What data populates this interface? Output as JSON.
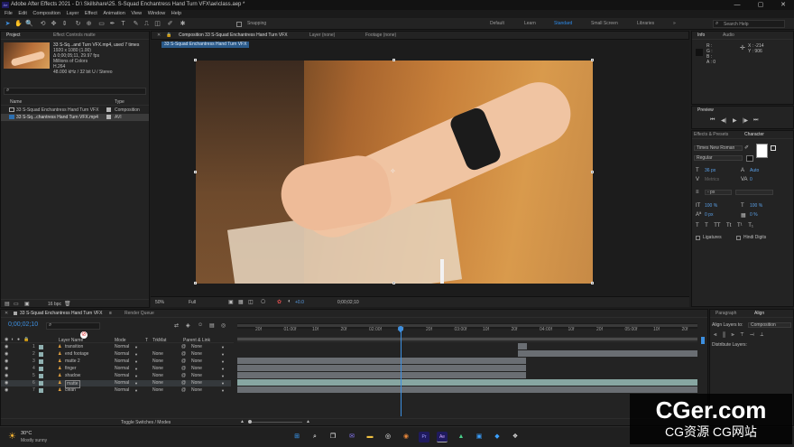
{
  "window": {
    "title": "Adobe After Effects 2021 - D:\\ Skillshare\\25. S-Squad Enchantress Hand Turn VFX\\ae\\class.aep *",
    "app_icon": "Ae"
  },
  "menu": [
    "File",
    "Edit",
    "Composition",
    "Layer",
    "Effect",
    "Animation",
    "View",
    "Window",
    "Help"
  ],
  "toolbar": {
    "snapping": "Snapping",
    "workspaces": [
      "Default",
      "Learn",
      "Standard",
      "Small Screen",
      "Libraries"
    ],
    "active_workspace": "Standard",
    "more": "»",
    "search_placeholder": "Search Help"
  },
  "project_panel": {
    "tabs": [
      "Project",
      "Effect Controls matte"
    ],
    "item_name": "33 S-Sq...and Turn VFX.mp4",
    "item_used": ", used 7 times",
    "info": [
      "1920 x 1080 (1.00)",
      "Δ 0;00;05;11, 29.97 fps",
      "Millions of Colors",
      "H.264",
      "48.000 kHz / 32 bit U / Stereo"
    ],
    "columns": {
      "name": "Name",
      "type": "Type"
    },
    "rows": [
      {
        "name": "33 S-Squad Enchantress Hand Turn VFX",
        "type": "Composition",
        "color": "#b5b5b5"
      },
      {
        "name": "33 S-Sq...chantress Hand Turn VFX.mp4",
        "type": "AVI",
        "color": "#b5b5b5"
      }
    ],
    "bpc": "16 bpc"
  },
  "viewer": {
    "tab_composition": "Composition 33 S-Squad Enchantress Hand Turn VFX",
    "tab_layer": "Layer (none)",
    "tab_footage": "Footage (none)",
    "comp_chip": "33 S-Squad Enchantress Hand Turn VFX",
    "zoom": "50%",
    "resolution": "Full",
    "exposure": "+0.0",
    "timecode": "0;00;02;10"
  },
  "info_panel": {
    "tabs": [
      "Info",
      "Audio"
    ],
    "x": "X : -214",
    "y": "Y : 906",
    "r": "R :",
    "g": "G :",
    "b": "B :",
    "a": "A : 0"
  },
  "preview": {
    "title": "Preview"
  },
  "effects": {
    "title": "Effects & Presets",
    "character_tab": "Character"
  },
  "character": {
    "font": "Times New Roman",
    "style": "Regular",
    "size": "36 px",
    "leading": "Auto",
    "kerning": "Metrics",
    "tracking": "0",
    "stroke": "- px",
    "vscale": "100 %",
    "hscale": "100 %",
    "baseline": "0 px",
    "tsume": "0 %",
    "glyphs": [
      "T",
      "T",
      "TT",
      "Tt",
      "T¹",
      "T₁"
    ],
    "ligatures": "Ligatures",
    "hindi": "Hindi Digits"
  },
  "timeline": {
    "tab": "33 S-Squad Enchantress Hand Turn VFX",
    "render_queue": "Render Queue",
    "timecode": "0;00;02;10",
    "columns": {
      "layer": "Layer Name",
      "mode": "Mode",
      "t": "T",
      "trkmat": "TrkMat",
      "parent": "Parent & Link"
    },
    "layers": [
      {
        "num": "1",
        "name": "transition",
        "mode": "Normal",
        "trkmat": "",
        "parent": "None",
        "color": "#8fb0b0"
      },
      {
        "num": "2",
        "name": "end footage",
        "mode": "Normal",
        "trkmat": "None",
        "parent": "None",
        "color": "#8fb0b0"
      },
      {
        "num": "3",
        "name": "matte 2",
        "mode": "Normal",
        "trkmat": "None",
        "parent": "None",
        "color": "#8fb0b0"
      },
      {
        "num": "4",
        "name": "finger",
        "mode": "Normal",
        "trkmat": "None",
        "parent": "None",
        "color": "#8fb0b0"
      },
      {
        "num": "5",
        "name": "shadow",
        "mode": "Normal",
        "trkmat": "None",
        "parent": "None",
        "color": "#8fb0b0"
      },
      {
        "num": "6",
        "name": "matte",
        "mode": "Normal",
        "trkmat": "None",
        "parent": "None",
        "color": "#8fb0b0"
      },
      {
        "num": "7",
        "name": "clean",
        "mode": "Normal",
        "trkmat": "None",
        "parent": "None",
        "color": "#8fb0b0"
      }
    ],
    "ticks": [
      "20f",
      "01:00f",
      "10f",
      "20f",
      "02:00f",
      "10f",
      "20f",
      "03:00f",
      "10f",
      "20f",
      "04:00f",
      "10f",
      "20f",
      "05:00f",
      "10f",
      "20f"
    ],
    "toggle": "Toggle Switches / Modes",
    "playhead_fraction": 0.354
  },
  "align_panel": {
    "tabs": [
      "Paragraph",
      "Align"
    ],
    "align_layers_to": "Align Layers to:",
    "target": "Composition",
    "distribute": "Distribute Layers:"
  },
  "taskbar": {
    "weather_temp": "30°C",
    "weather_desc": "Mostly sunny"
  },
  "watermark": {
    "main": "CGer.com",
    "sub": "CG资源  CG网站"
  }
}
